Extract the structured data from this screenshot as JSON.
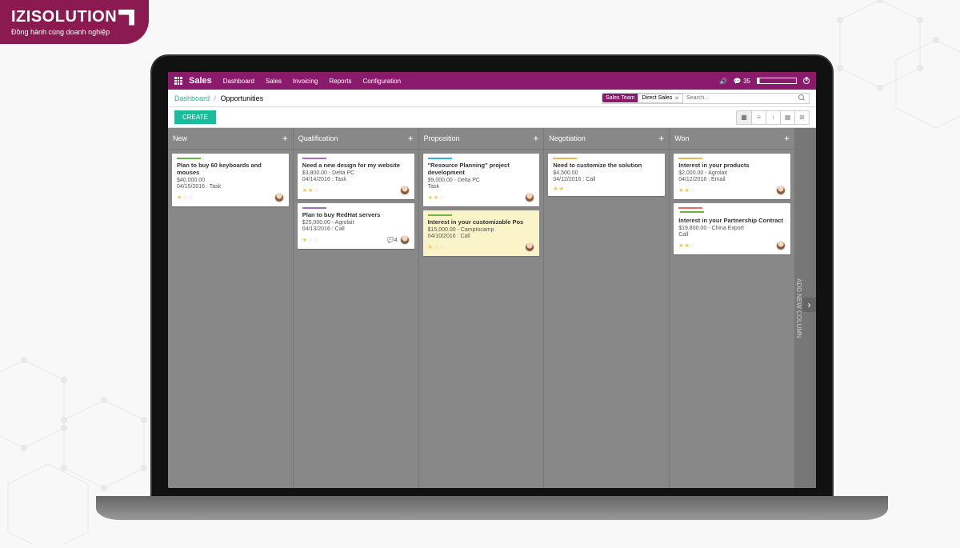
{
  "brand": {
    "name": "IZISOLUTION",
    "tagline": "Đồng hành cùng doanh nghiệp"
  },
  "topnav": {
    "title": "Sales",
    "menu": [
      "Dashboard",
      "Sales",
      "Invoicing",
      "Reports",
      "Configuration"
    ],
    "msg_count": "35"
  },
  "breadcrumb": {
    "parent": "Dashboard",
    "current": "Opportunities"
  },
  "filter": {
    "label": "Sales Team",
    "value": "Direct Sales"
  },
  "search": {
    "placeholder": "Search..."
  },
  "controls": {
    "create": "CREATE"
  },
  "addcol": {
    "label": "ADD NEW COLUMN"
  },
  "columns": [
    {
      "name": "New",
      "cards": [
        {
          "bar": "#6db33f",
          "title": "Plan to buy 60 keyboards and mouses",
          "sub": "$40,000.00",
          "meta": "04/15/2016 : Task",
          "stars": 1,
          "avatar": true
        }
      ]
    },
    {
      "name": "Qualification",
      "cards": [
        {
          "bar": "#a56cc1",
          "title": "Need a new design for my website",
          "sub": "$3,800.00 - Delta PC",
          "meta": "04/14/2016 : Task",
          "stars": 2,
          "avatar": true
        },
        {
          "bar": "#a56cc1",
          "title": "Plan to buy RedHat servers",
          "sub": "$25,000.00 - Agrolait",
          "meta": "04/13/2016 : Call",
          "stars": 1,
          "avatar": true,
          "messages": "4"
        }
      ]
    },
    {
      "name": "Proposition",
      "cards": [
        {
          "bar": "#2fb5d8",
          "title": "\"Resource Planning\" project development",
          "sub": "$9,000.00 - Delta PC",
          "meta": "Task",
          "stars": 2,
          "avatar": true
        },
        {
          "bar": "#6db33f",
          "title": "Interest in your customizable Pos",
          "sub": "$15,000.00 - Camptocamp",
          "meta": "04/10/2016 : Call",
          "stars": 1,
          "avatar": true,
          "hl": true
        }
      ]
    },
    {
      "name": "Negotiation",
      "cards": [
        {
          "bar": "#e8b84f",
          "title": "Need to customize the solution",
          "sub": "$4,500.00",
          "meta": "04/12/2016 : Call",
          "stars": 2
        }
      ]
    },
    {
      "name": "Won",
      "cards": [
        {
          "bar": "#e8b84f",
          "title": "Interest in your products",
          "sub": "$2,000.00 - Agrolait",
          "meta": "04/12/2016 : Email",
          "stars": 2,
          "avatar": true
        },
        {
          "bar2": true,
          "bar": "#e86b5c",
          "title": "Interest in your Partnership Contract",
          "sub": "$19,800.00 - China Export",
          "meta": "Call",
          "stars": 2,
          "avatar": true
        }
      ]
    }
  ]
}
